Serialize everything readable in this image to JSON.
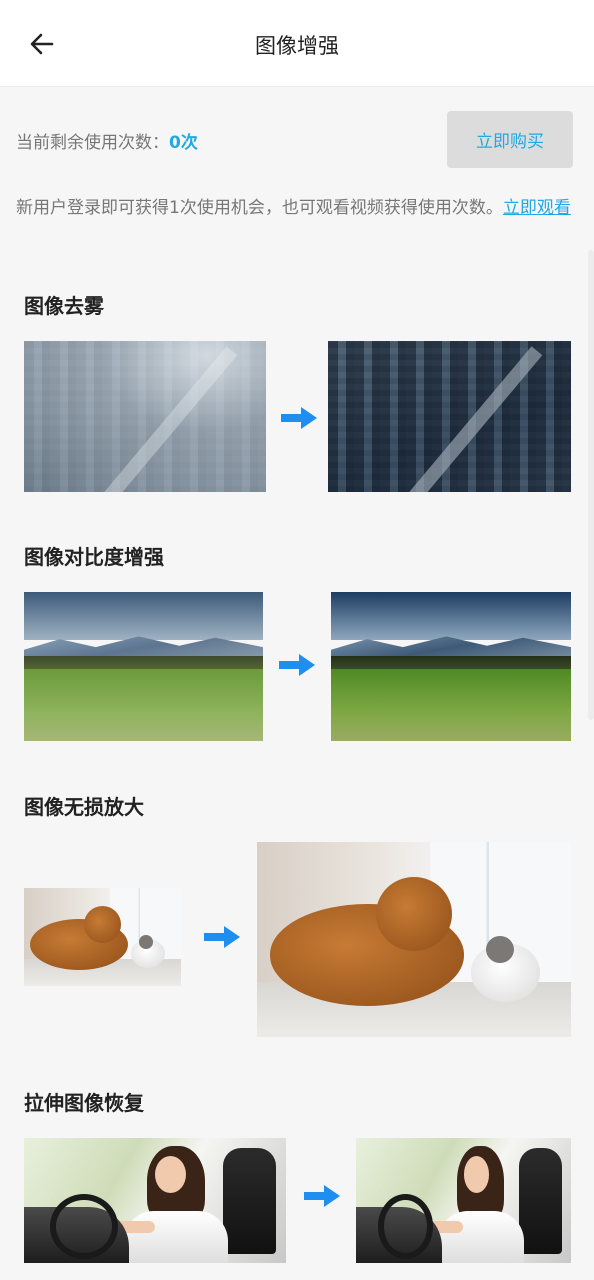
{
  "header": {
    "title": "图像增强",
    "back_icon": "arrow-left-icon"
  },
  "quota": {
    "label": "当前剩余使用次数：",
    "value": "0次",
    "buy_label": "立即购买"
  },
  "notice": {
    "text": "新用户登录即可获得1次使用机会，也可观看视频获得使用次数。",
    "link": "立即观看"
  },
  "features": [
    {
      "title": "图像去雾"
    },
    {
      "title": "图像对比度增强"
    },
    {
      "title": "图像无损放大"
    },
    {
      "title": "拉伸图像恢复"
    }
  ],
  "colors": {
    "accent": "#21a9e1",
    "arrow": "#1e8ef0",
    "buy_button_bg": "#dcdcdc"
  }
}
